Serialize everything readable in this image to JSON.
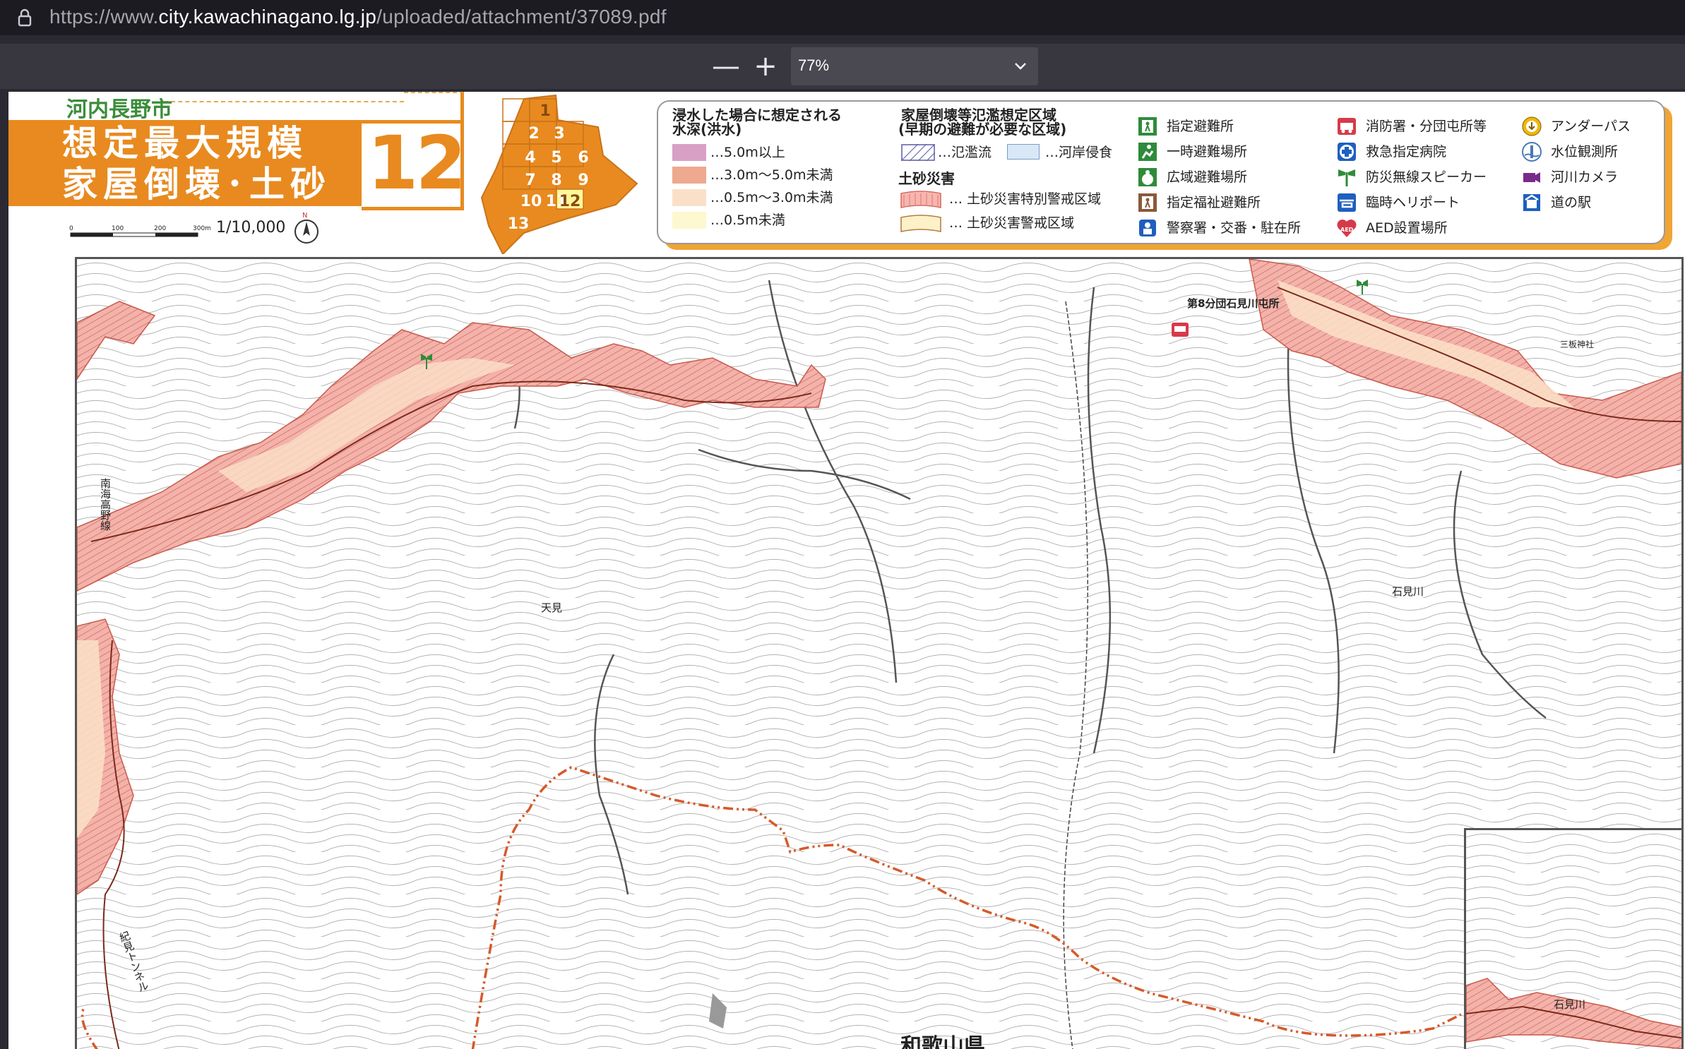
{
  "browser": {
    "url_scheme": "https://www.",
    "url_host": "city.kawachinagano.lg.jp",
    "url_path": "/uploaded/attachment/37089.pdf"
  },
  "pdf_toolbar": {
    "zoom_out": "—",
    "zoom_in": "+",
    "zoom_level": "77%"
  },
  "sheet": {
    "city": "河内長野市",
    "title_line1": "想定最大規模",
    "title_line2": "家屋倒壊･土砂",
    "map_number": "12",
    "scale_text": "1/10,000",
    "scale_ticks": [
      "0",
      "100",
      "200",
      "300m"
    ],
    "north_label": "N"
  },
  "index_map": {
    "cells": [
      "1",
      "2",
      "3",
      "4",
      "5",
      "6",
      "7",
      "8",
      "9",
      "10",
      "11",
      "12",
      "13"
    ],
    "current": "12"
  },
  "legend": {
    "flood_title_1": "浸水した場合に想定される",
    "flood_title_2": "水深(洪水)",
    "flood_items": [
      {
        "label": "…5.0m以上",
        "color": "#d9a0c6"
      },
      {
        "label": "…3.0m〜5.0m未満",
        "color": "#eea98f"
      },
      {
        "label": "…0.5m〜3.0m未満",
        "color": "#fbe0c8"
      },
      {
        "label": "…0.5m未満",
        "color": "#fdf8cf"
      }
    ],
    "collapse_title_1": "家屋倒壊等氾濫想定区域",
    "collapse_title_2": "(早期の避難が必要な区域)",
    "collapse_items": [
      "…氾濫流",
      "…河岸侵食"
    ],
    "sediment_title": "土砂災害",
    "sediment_items": [
      "… 土砂災害特別警戒区域",
      "… 土砂災害警戒区域"
    ],
    "facilities_col1": [
      {
        "icon": "designated-shelter",
        "label": "指定避難所"
      },
      {
        "icon": "temporary-evacuation-site",
        "label": "一時避難場所"
      },
      {
        "icon": "wide-area-evacuation-site",
        "label": "広域避難場所"
      },
      {
        "icon": "welfare-shelter",
        "label": "指定福祉避難所"
      },
      {
        "icon": "police",
        "label": "警察署・交番・駐在所"
      }
    ],
    "facilities_col2": [
      {
        "icon": "fire-station",
        "label": "消防署・分団屯所等"
      },
      {
        "icon": "emergency-hospital",
        "label": "救急指定病院"
      },
      {
        "icon": "disaster-speaker",
        "label": "防災無線スピーカー"
      },
      {
        "icon": "heliport",
        "label": "臨時ヘリポート"
      },
      {
        "icon": "aed",
        "label": "AED設置場所"
      }
    ],
    "facilities_col3": [
      {
        "icon": "underpass",
        "label": "アンダーパス"
      },
      {
        "icon": "water-level-station",
        "label": "水位観測所"
      },
      {
        "icon": "river-camera",
        "label": "河川カメラ"
      },
      {
        "icon": "roadside-station",
        "label": "道の駅"
      }
    ],
    "aed_badge": "AED"
  },
  "map_labels": {
    "railway": "南海高野線",
    "amami": "天見",
    "fire_post": "第8分団石見川屯所",
    "shrine": "三板神社",
    "river1": "石見川",
    "tunnel": "紀見トンネル",
    "prefecture": "和歌山県",
    "river_inset": "石見川"
  },
  "colors": {
    "orange": "#e88a1f",
    "green": "#3b8d3a",
    "hazard_red": "#e8a29a",
    "boundary": "#d65a2a"
  }
}
